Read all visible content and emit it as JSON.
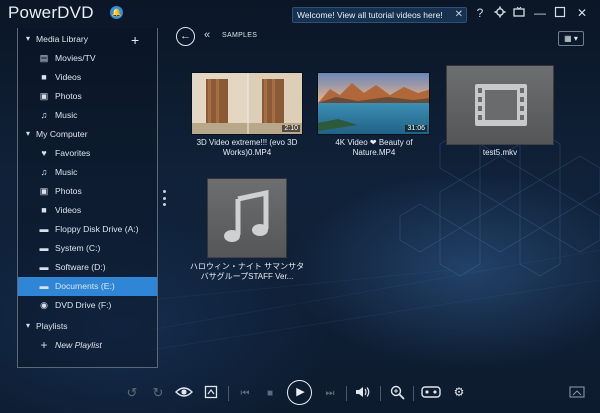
{
  "app": {
    "title": "PowerDVD",
    "notification_icon": "bell-icon",
    "welcome_banner": "Welcome! View all tutorial videos here!",
    "welcome_close": "✕",
    "titlebar_icons": [
      "help-icon",
      "settings-icon",
      "tv-mode-icon",
      "minimize-icon",
      "maximize-icon",
      "close-icon"
    ]
  },
  "sidebar": {
    "media_library": {
      "label": "Media Library",
      "add_label": "+",
      "items": [
        {
          "label": "Movies/TV",
          "icon": "film-icon"
        },
        {
          "label": "Videos",
          "icon": "video-camera-icon"
        },
        {
          "label": "Photos",
          "icon": "photo-icon"
        },
        {
          "label": "Music",
          "icon": "music-note-icon"
        }
      ]
    },
    "my_computer": {
      "label": "My Computer",
      "items": [
        {
          "label": "Favorites",
          "icon": "heart-icon"
        },
        {
          "label": "Music",
          "icon": "music-note-icon"
        },
        {
          "label": "Photos",
          "icon": "photo-icon"
        },
        {
          "label": "Videos",
          "icon": "video-camera-icon"
        },
        {
          "label": "Floppy Disk Drive (A:)",
          "icon": "drive-icon"
        },
        {
          "label": "System (C:)",
          "icon": "drive-icon"
        },
        {
          "label": "Software (D:)",
          "icon": "drive-icon"
        },
        {
          "label": "Documents (E:)",
          "icon": "drive-icon",
          "selected": true
        },
        {
          "label": "DVD Drive (F:)",
          "icon": "disc-icon"
        }
      ]
    },
    "playlists": {
      "label": "Playlists",
      "items": [
        {
          "label": "New Playlist",
          "icon": "plus-icon"
        }
      ]
    }
  },
  "content": {
    "breadcrumb": "SAMPLES",
    "back_icon": "back-arrow-icon",
    "view_mode_icon": "grid-view-icon",
    "files": [
      {
        "title": "3D Video extreme!!! (evo 3D Works)0.MP4",
        "duration": "2:10",
        "kind": "video"
      },
      {
        "title": "4K Video ❤ Beauty of Nature.MP4",
        "duration": "31:06",
        "kind": "video"
      },
      {
        "title": "test5.mkv",
        "duration": "",
        "kind": "placeholder-video"
      },
      {
        "title": "ハロウィン・ナイト サマンサタバサグループSTAFF Ver...",
        "duration": "",
        "kind": "placeholder-music"
      }
    ]
  },
  "controls": {
    "icons": [
      "rotate-left-icon",
      "rotate-right-icon",
      "eye-icon",
      "crop-icon",
      "previous-icon",
      "stop-icon",
      "play-icon",
      "next-icon",
      "volume-icon",
      "zoom-icon",
      "vr-headset-icon",
      "effects-icon",
      "cast-icon"
    ],
    "accent_color": "#2f86d6"
  }
}
